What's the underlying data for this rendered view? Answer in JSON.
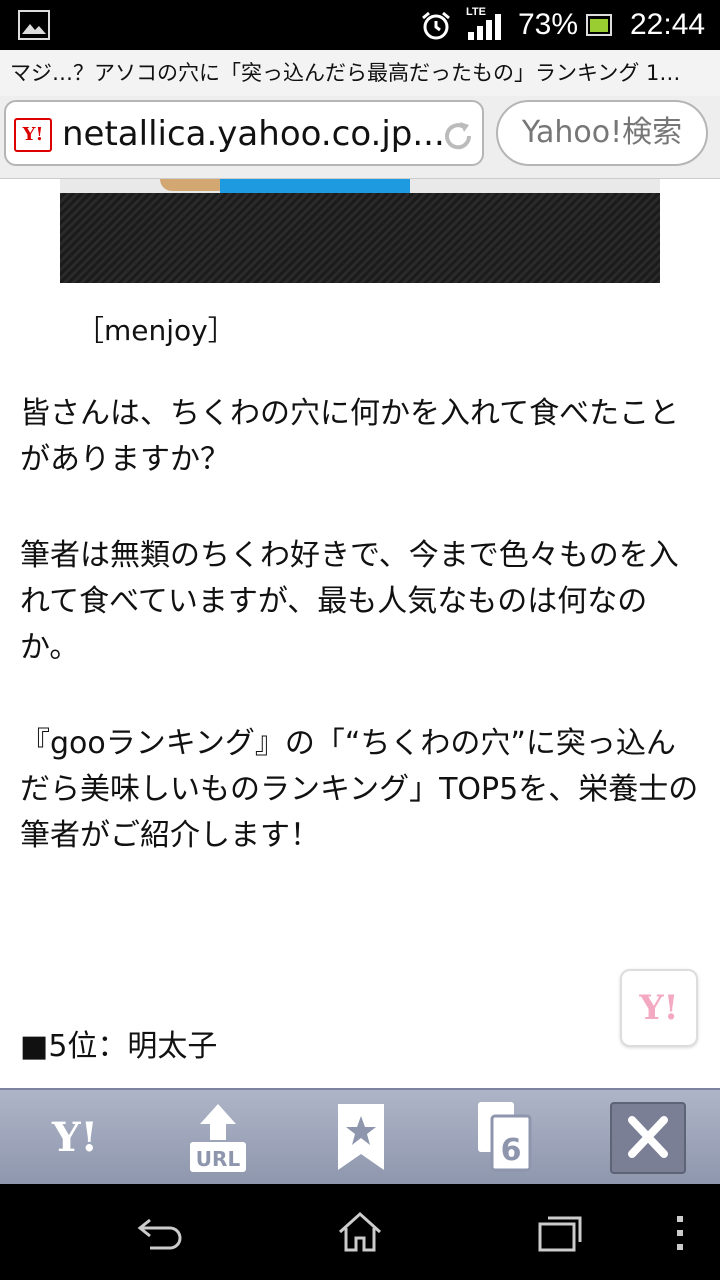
{
  "status_bar": {
    "lte_label": "LTE",
    "battery_percent": "73%",
    "time": "22:44",
    "battery_fill": 0.73
  },
  "browser": {
    "page_title": "マジ…？アソコの穴に「突っ込んだら最高だったもの」ランキング 1…",
    "url": "netallica.yahoo.co.jp...",
    "search_button": "Yahoo!検索",
    "yahoo_logo": "Y!"
  },
  "article": {
    "caption": "［menjoy］",
    "paragraphs": [
      "皆さんは、ちくわの穴に何かを入れて食べたことがありますか？",
      "筆者は無類のちくわ好きで、今まで色々ものを入れて食べていますが、最も人気なものは何なのか。",
      "『gooランキング』の「“ちくわの穴”に突っ込んだら美味しいものランキング」TOP5を、栄養士の筆者がご紹介します！"
    ],
    "rank_heading": "■5位：明太子"
  },
  "toolbar": {
    "yahoo_label": "Y!",
    "url_label": "URL",
    "tabs_count": "6"
  },
  "float_button": "Y!",
  "icons": {
    "gallery": "image-icon",
    "alarm": "alarm-clock-icon",
    "signal": "signal-icon",
    "battery": "battery-icon",
    "reload": "reload-icon",
    "bookmark": "bookmark-star-icon",
    "tabs": "tabs-icon",
    "close": "close-icon",
    "back": "back-icon",
    "home": "home-icon",
    "recents": "recent-apps-icon",
    "menu": "menu-dots-icon"
  },
  "colors": {
    "status_bar": "#000000",
    "toolbar": "#9aa1b7",
    "yahoo_red": "#dd0000",
    "float_y_pink": "#f4a9c3"
  }
}
